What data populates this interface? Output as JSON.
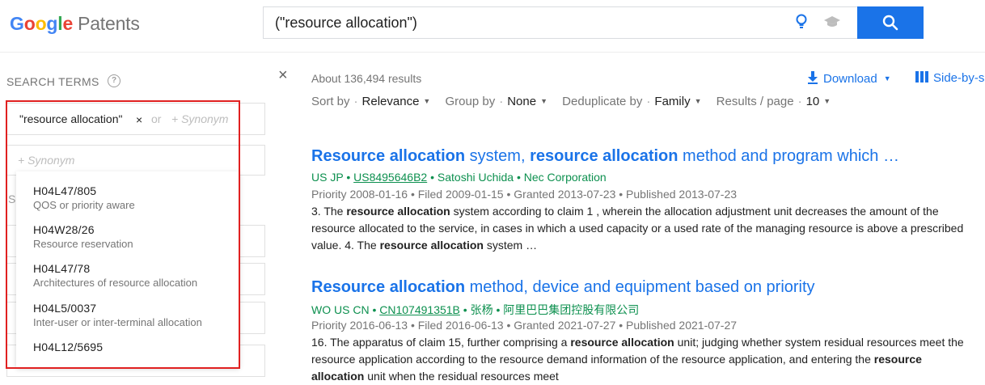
{
  "header": {
    "logo_letters": [
      "G",
      "o",
      "o",
      "g",
      "l",
      "e"
    ],
    "logo_product": "Patents",
    "search_value": "(\"resource allocation\")",
    "icons": [
      "lightbulb-icon",
      "graduation-cap-icon",
      "search-icon"
    ],
    "brand_color": "#1a73e8"
  },
  "sidebar": {
    "label": "SEARCH TERMS",
    "help": "?",
    "close": "×",
    "term": "\"resource allocation\"",
    "chip_remove": "×",
    "or": "or",
    "synonym_placeholder": "+ Synonym",
    "synonym_placeholder2": "+ Synonym",
    "partial_letter": "SI"
  },
  "dropdown": {
    "items": [
      {
        "code": "H04L47/805",
        "desc": "QOS or priority aware"
      },
      {
        "code": "H04W28/26",
        "desc": "Resource reservation"
      },
      {
        "code": "H04L47/78",
        "desc": "Architectures of resource allocation"
      },
      {
        "code": "H04L5/0037",
        "desc": "Inter-user or inter-terminal allocation"
      },
      {
        "code": "H04L12/5695",
        "desc": ""
      }
    ],
    "highlight_color": "#e02020"
  },
  "results_bar": {
    "count": "About 136,494 results",
    "download": "Download",
    "side_by_side": "Side-by-s",
    "sort_key": "Sort by",
    "sort_val": "Relevance",
    "group_key": "Group by",
    "group_val": "None",
    "dedup_key": "Deduplicate by",
    "dedup_val": "Family",
    "per_page_key": "Results / page",
    "per_page_val": "10",
    "sep": "·"
  },
  "results": [
    {
      "title_bold_1": "Resource allocation",
      "title_plain_1": " system, ",
      "title_bold_2": "resource allocation",
      "title_plain_2": " method and program which …",
      "countries": "US JP",
      "patent_id": "US8495646B2",
      "inventor": "Satoshi Uchida",
      "assignee": "Nec Corporation",
      "dates": "Priority 2008-01-16 • Filed 2009-01-15 • Granted 2013-07-23 • Published 2013-07-23",
      "snippet_parts": [
        "3. The ",
        "resource allocation",
        " system according to claim 1 , wherein the allocation adjustment unit decreases the amount of the resource allocated to the service, in cases in which a used capacity or a used rate of the managing resource is above a prescribed value. 4. The ",
        "resource allocation",
        " system …"
      ]
    },
    {
      "title_bold_1": "Resource allocation",
      "title_plain_1": " method, device and equipment based on priority",
      "countries": "WO US CN",
      "patent_id": "CN107491351B",
      "inventor": "张杨",
      "assignee": "阿里巴巴集团控股有限公司",
      "dates": "Priority 2016-06-13 • Filed 2016-06-13 • Granted 2021-07-27 • Published 2021-07-27",
      "snippet_parts": [
        "16. The apparatus of claim 15, further comprising a ",
        "resource allocation",
        " unit; judging whether system residual resources meet the resource application according to the resource demand information of the resource application, and entering the ",
        "resource allocation",
        " unit when the residual resources meet"
      ]
    }
  ]
}
